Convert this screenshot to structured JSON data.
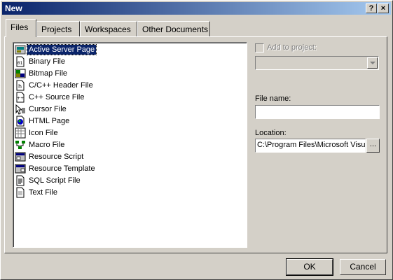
{
  "window": {
    "title": "New",
    "help_glyph": "?",
    "close_glyph": "×"
  },
  "tabs": [
    {
      "label": "Files",
      "active": true
    },
    {
      "label": "Projects",
      "active": false
    },
    {
      "label": "Workspaces",
      "active": false
    },
    {
      "label": "Other Documents",
      "active": false
    }
  ],
  "file_types": [
    {
      "label": "Active Server Page",
      "icon": "asp-page-icon",
      "selected": true
    },
    {
      "label": "Binary File",
      "icon": "binary-file-icon"
    },
    {
      "label": "Bitmap File",
      "icon": "bitmap-file-icon"
    },
    {
      "label": "C/C++ Header File",
      "icon": "header-file-icon"
    },
    {
      "label": "C++ Source File",
      "icon": "source-file-icon"
    },
    {
      "label": "Cursor File",
      "icon": "cursor-file-icon"
    },
    {
      "label": "HTML Page",
      "icon": "html-page-icon"
    },
    {
      "label": "Icon File",
      "icon": "icon-file-icon"
    },
    {
      "label": "Macro File",
      "icon": "macro-file-icon"
    },
    {
      "label": "Resource Script",
      "icon": "resource-script-icon"
    },
    {
      "label": "Resource Template",
      "icon": "resource-template-icon"
    },
    {
      "label": "SQL Script File",
      "icon": "sql-script-icon"
    },
    {
      "label": "Text File",
      "icon": "text-file-icon"
    }
  ],
  "add_to_project": {
    "label": "Add to project:",
    "checked": false,
    "enabled": false,
    "value": ""
  },
  "file_name": {
    "label": "File name:",
    "value": ""
  },
  "location": {
    "label": "Location:",
    "value": "C:\\Program Files\\Microsoft Visual",
    "browse_label": "..."
  },
  "buttons": {
    "ok": "OK",
    "cancel": "Cancel"
  },
  "colors": {
    "selection": "#0a246a",
    "face": "#d4d0c8",
    "title_start": "#0a246a",
    "title_end": "#a6caf0"
  }
}
